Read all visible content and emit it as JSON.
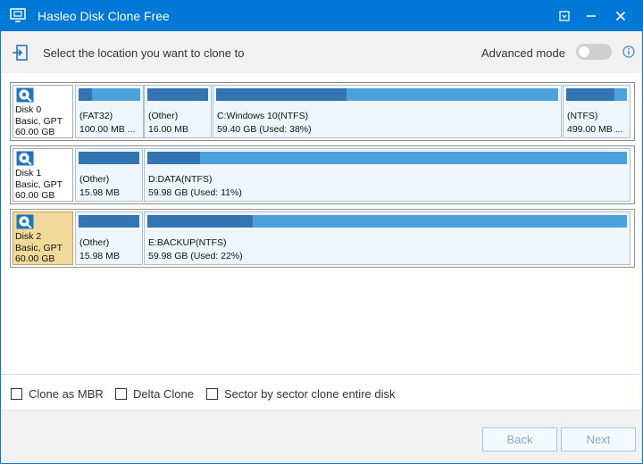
{
  "window": {
    "title": "Hasleo Disk Clone Free"
  },
  "header": {
    "instruction": "Select the location you want to clone to",
    "advanced_mode_label": "Advanced mode",
    "advanced_mode_on": false
  },
  "disks": [
    {
      "lines": [
        "Disk 0",
        "Basic, GPT",
        "60.00 GB"
      ],
      "selected": false,
      "partitions": [
        {
          "line1": "(FAT32)",
          "line2": "100.00 MB ...",
          "used_fraction": 0.22
        },
        {
          "line1": "(Other)",
          "line2": "16.00 MB",
          "used_fraction": 1.0
        },
        {
          "line1": "C:Windows 10(NTFS)",
          "line2": "59.40 GB (Used: 38%)",
          "used_fraction": 0.38
        },
        {
          "line1": "(NTFS)",
          "line2": "499.00 MB ...",
          "used_fraction": 0.8
        }
      ]
    },
    {
      "lines": [
        "Disk 1",
        "Basic, GPT",
        "60.00 GB"
      ],
      "selected": false,
      "partitions": [
        {
          "line1": "(Other)",
          "line2": "15.98 MB",
          "used_fraction": 1.0
        },
        {
          "line1": "D:DATA(NTFS)",
          "line2": "59.98 GB (Used: 11%)",
          "used_fraction": 0.11
        }
      ]
    },
    {
      "lines": [
        "Disk 2",
        "Basic, GPT",
        "60.00 GB"
      ],
      "selected": true,
      "partitions": [
        {
          "line1": "(Other)",
          "line2": "15.98 MB",
          "used_fraction": 1.0
        },
        {
          "line1": "E:BACKUP(NTFS)",
          "line2": "59.98 GB (Used: 22%)",
          "used_fraction": 0.22
        }
      ]
    }
  ],
  "options": {
    "clone_as_mbr": "Clone as MBR",
    "delta_clone": "Delta Clone",
    "sector_clone": "Sector by sector clone entire disk"
  },
  "footer": {
    "back_label": "Back",
    "next_label": "Next"
  },
  "colors": {
    "titlebar": "#0078d7",
    "partition_free": "#4aa1db",
    "partition_used": "#3374b3",
    "selected_disk": "#f1d999"
  },
  "icons": {
    "app": "monitor-clone-icon",
    "header": "clone-target-icon",
    "disk": "disk-magnifier-icon",
    "info": "info-icon"
  }
}
